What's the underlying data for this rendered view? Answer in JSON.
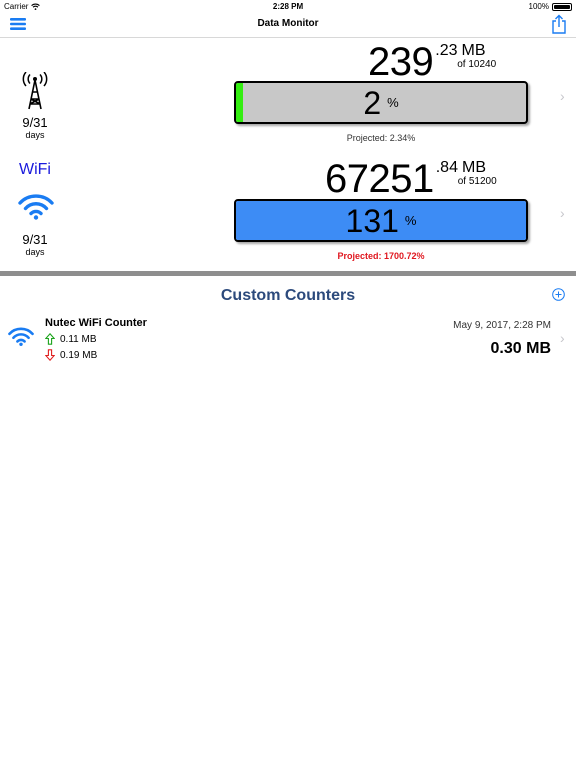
{
  "status_bar": {
    "carrier": "Carrier",
    "time": "2:28 PM",
    "battery": "100%"
  },
  "nav": {
    "title": "Data Monitor",
    "menu_icon": "hamburger-menu-icon",
    "share_icon": "share-icon"
  },
  "cellular": {
    "icon": "cell-tower-icon",
    "used_int": "239",
    "used_dec": ".23",
    "unit": "MB",
    "limit": "of 10240",
    "percent": "2",
    "percent_sign": "%",
    "fill_fraction": 0.0234,
    "projected": "Projected: 2.34%",
    "days": "9/31",
    "days_label": "days"
  },
  "wifi": {
    "label": "WiFi",
    "icon": "wifi-icon",
    "used_int": "67251",
    "used_dec": ".84",
    "unit": "MB",
    "limit": "of 51200",
    "percent": "131",
    "percent_sign": "%",
    "fill_fraction": 1.0,
    "projected": "Projected: 1700.72%",
    "days": "9/31",
    "days_label": "days"
  },
  "custom_counters": {
    "title": "Custom Counters",
    "items": [
      {
        "name": "Nutec WiFi Counter",
        "upload": "0.11 MB",
        "download": "0.19 MB",
        "date": "May 9, 2017, 2:28 PM",
        "total": "0.30 MB"
      }
    ]
  },
  "colors": {
    "accent": "#1a7cf2",
    "cell_fill": "#33ee11",
    "wifi_fill": "#3d8cf5",
    "bar_bg": "#c8c8c8",
    "upload_green": "#1aa31a",
    "download_red": "#e02020",
    "warning_red": "#e0161e",
    "header_navy": "#2c4a7c"
  }
}
